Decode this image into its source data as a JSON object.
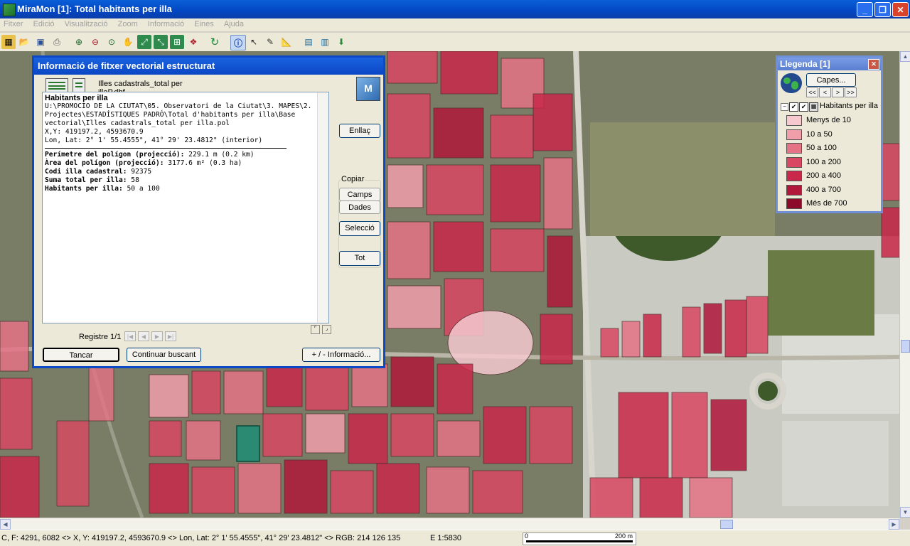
{
  "window": {
    "title": "MiraMon [1]:  Total habitants per illa"
  },
  "menu": [
    "Fitxer",
    "Edició",
    "Visualització",
    "Zoom",
    "Informació",
    "Eines",
    "Ajuda"
  ],
  "toolbar_icons": [
    "new-map-icon",
    "open-icon",
    "save-icon",
    "print-icon",
    "zoom-in-icon",
    "zoom-out-icon",
    "pan-hand-icon",
    "zoom-previous-icon",
    "zoom-all-icon",
    "zoom-layer-icon",
    "layers-icon",
    "refresh-icon",
    "info-icon",
    "select-arrow-icon",
    "edit-tool-icon",
    "measure-icon",
    "window-icon",
    "table-icon",
    "download-icon"
  ],
  "dialog": {
    "title": "Informació de fitxer vectorial estructurat",
    "file_name": "Illes cadastrals_total per illaP.dbf",
    "info": {
      "layer_name": "Habitants per illa",
      "path": "U:\\PROMOCIO DE LA CIUTAT\\05. Observatori de la Ciutat\\3. MAPES\\2. Projectes\\ESTADÍSTIQUES PADRÓ\\Total d'habitants per illa\\Base vectorial\\Illes cadastrals_total per illa.pol",
      "xy": "X,Y: 419197.2, 4593670.9",
      "lonlat": "Lon, Lat: 2° 1' 55.4555\", 41° 29' 23.4812\" (interior)",
      "fields": [
        {
          "label": "Perímetre del polígon (projecció):",
          "value": " 229.1 m (0.2 km)"
        },
        {
          "label": "Àrea del polígon (projecció):",
          "value": " 3177.6 m² (0.3 ha)"
        },
        {
          "label": "Codi illa cadastral:",
          "value": " 92375"
        },
        {
          "label": "Suma total per illa:",
          "value": " 58"
        },
        {
          "label": "Habitants per illa:",
          "value": " 50 a 100"
        }
      ]
    },
    "buttons": {
      "enllac": "Enllaç",
      "copiar_group": "Copiar",
      "camps": "Camps",
      "dades": "Dades",
      "seleccio": "Selecció",
      "tot": "Tot",
      "tancar": "Tancar",
      "continuar": "Continuar buscant",
      "mes_info": "+ / - Informació..."
    },
    "record_label": "Registre 1/1",
    "logo_text": "M"
  },
  "legend": {
    "title": "Llegenda [1]",
    "capes_button": "Capes...",
    "nav_buttons": [
      "<<",
      "<",
      ">",
      ">>"
    ],
    "layer_name": "Habitants per illa",
    "classes": [
      {
        "label": "Menys de 10",
        "color": "#f5c9cf"
      },
      {
        "label": "10 a 50",
        "color": "#ef9eaa"
      },
      {
        "label": "50 a 100",
        "color": "#e57386"
      },
      {
        "label": "100 a 200",
        "color": "#d94862"
      },
      {
        "label": "200 a 400",
        "color": "#c9284a"
      },
      {
        "label": "400 a 700",
        "color": "#b0173a"
      },
      {
        "label": "Més de 700",
        "color": "#8c0a2a"
      }
    ]
  },
  "status": {
    "coords": "C, F: 4291, 6082 <> X, Y: 419197.2, 4593670.9 <> Lon, Lat: 2° 1' 55.4555\", 41° 29' 23.4812\" <> RGB:  214 126 135",
    "scale": "E 1:5830",
    "scalebar_start": "0",
    "scalebar_end": "200 m"
  }
}
